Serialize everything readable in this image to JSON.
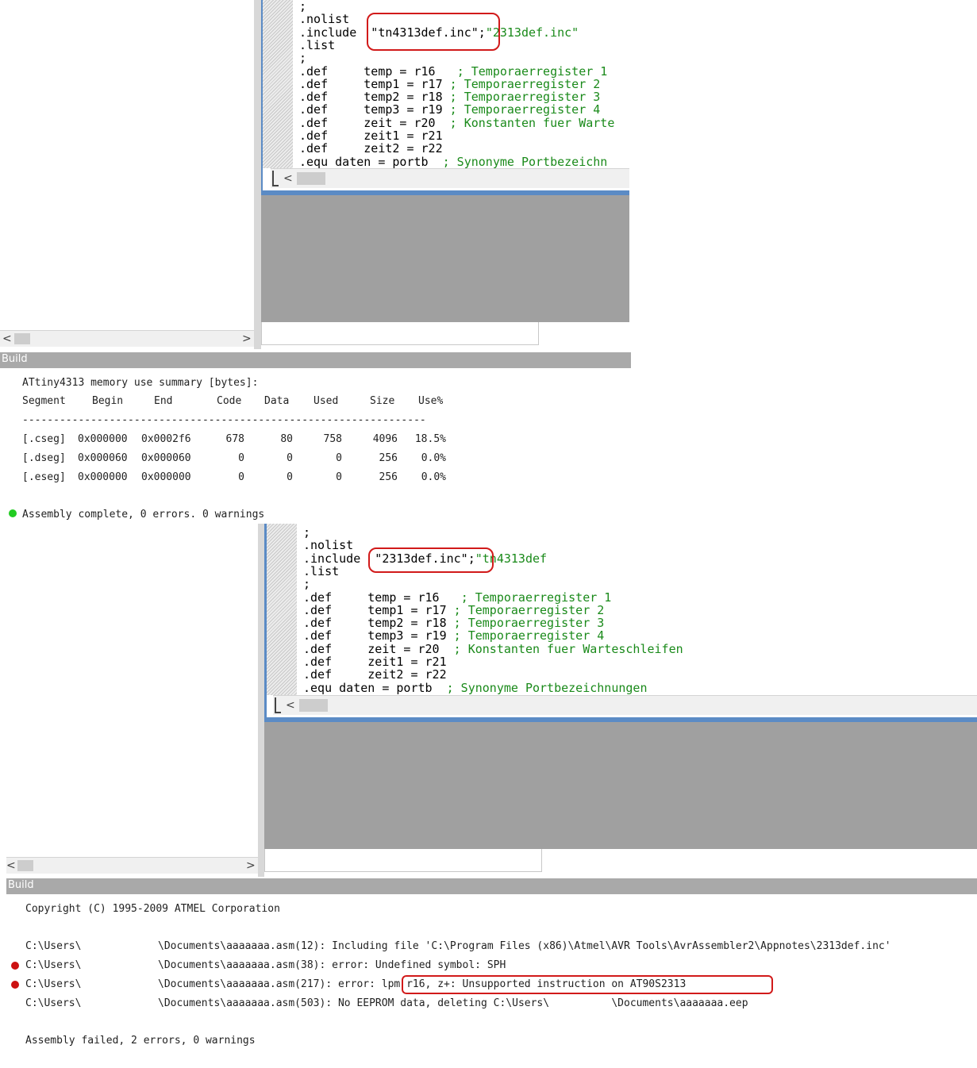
{
  "top_editor": {
    "lines": [
      {
        "text": ";",
        "comment": ""
      },
      {
        "text": ".nolist",
        "comment": ""
      },
      {
        "text": ".include  \"tn4313def.inc\";",
        "comment": "\"2313def.inc\""
      },
      {
        "text": ".list",
        "comment": ""
      },
      {
        "text": ";",
        "comment": ""
      },
      {
        "text": ".def     temp = r16   ",
        "comment": "; Temporaerregister 1"
      },
      {
        "text": ".def     temp1 = r17 ",
        "comment": "; Temporaerregister 2"
      },
      {
        "text": ".def     temp2 = r18 ",
        "comment": "; Temporaerregister 3"
      },
      {
        "text": ".def     temp3 = r19 ",
        "comment": "; Temporaerregister 4"
      },
      {
        "text": ".def     zeit = r20  ",
        "comment": "; Konstanten fuer Warte"
      },
      {
        "text": ".def     zeit1 = r21",
        "comment": ""
      },
      {
        "text": ".def     zeit2 = r22",
        "comment": ""
      },
      {
        "text": ".equ daten = portb  ",
        "comment": "; Synonyme Portbezeichn"
      }
    ]
  },
  "top_build": {
    "panel_title": "Build",
    "summary_title": "ATtiny4313 memory use summary [bytes]:",
    "columns": [
      "Segment",
      "Begin",
      "End",
      "Code",
      "Data",
      "Used",
      "Size",
      "Use%"
    ],
    "separator": "-----------------------------------------------------------------",
    "rows": [
      [
        "[.cseg]",
        "0x000000",
        "0x0002f6",
        "678",
        "80",
        "758",
        "4096",
        "18.5%"
      ],
      [
        "[.dseg]",
        "0x000060",
        "0x000060",
        "0",
        "0",
        "0",
        "256",
        "0.0%"
      ],
      [
        "[.eseg]",
        "0x000000",
        "0x000000",
        "0",
        "0",
        "0",
        "256",
        "0.0%"
      ]
    ],
    "status": "Assembly complete, 0 errors. 0 warnings",
    "status_color": "#22cc22"
  },
  "bottom_editor": {
    "lines": [
      {
        "text": ";",
        "comment": ""
      },
      {
        "text": ".nolist",
        "comment": ""
      },
      {
        "text": ".include  \"2313def.inc\";",
        "comment": "\"tn4313def"
      },
      {
        "text": ".list",
        "comment": ""
      },
      {
        "text": ";",
        "comment": ""
      },
      {
        "text": ".def     temp = r16   ",
        "comment": "; Temporaerregister 1"
      },
      {
        "text": ".def     temp1 = r17 ",
        "comment": "; Temporaerregister 2"
      },
      {
        "text": ".def     temp2 = r18 ",
        "comment": "; Temporaerregister 3"
      },
      {
        "text": ".def     temp3 = r19 ",
        "comment": "; Temporaerregister 4"
      },
      {
        "text": ".def     zeit = r20  ",
        "comment": "; Konstanten fuer Warteschleifen"
      },
      {
        "text": ".def     zeit1 = r21",
        "comment": ""
      },
      {
        "text": ".def     zeit2 = r22",
        "comment": ""
      },
      {
        "text": ".equ daten = portb  ",
        "comment": "; Synonyme Portbezeichnungen"
      }
    ]
  },
  "bottom_build": {
    "panel_title": "Build",
    "copyright": "Copyright (C) 1995-2009 ATMEL Corporation",
    "messages": [
      {
        "path": "C:\\Users\\",
        "detail": "\\Documents\\aaaaaaa.asm(12): Including file 'C:\\Program Files (x86)\\Atmel\\AVR Tools\\AvrAssembler2\\Appnotes\\2313def.inc'",
        "error": false
      },
      {
        "path": "C:\\Users\\",
        "detail": "\\Documents\\aaaaaaa.asm(38): error: Undefined symbol: SPH",
        "error": true
      },
      {
        "path": "C:\\Users\\",
        "detail": "\\Documents\\aaaaaaa.asm(217): error: lpm r16, z+: Unsupported instruction on AT90S2313",
        "error": true
      },
      {
        "path": "C:\\Users\\",
        "detail": "\\Documents\\aaaaaaa.asm(503): No EEPROM data, deleting C:\\Users\\          \\Documents\\aaaaaaa.eep",
        "error": false
      }
    ],
    "error_dot_color": "#cc1111",
    "status": "Assembly failed, 2 errors, 0 warnings"
  },
  "scroll_arrows": {
    "left": "<",
    "right": ">"
  }
}
